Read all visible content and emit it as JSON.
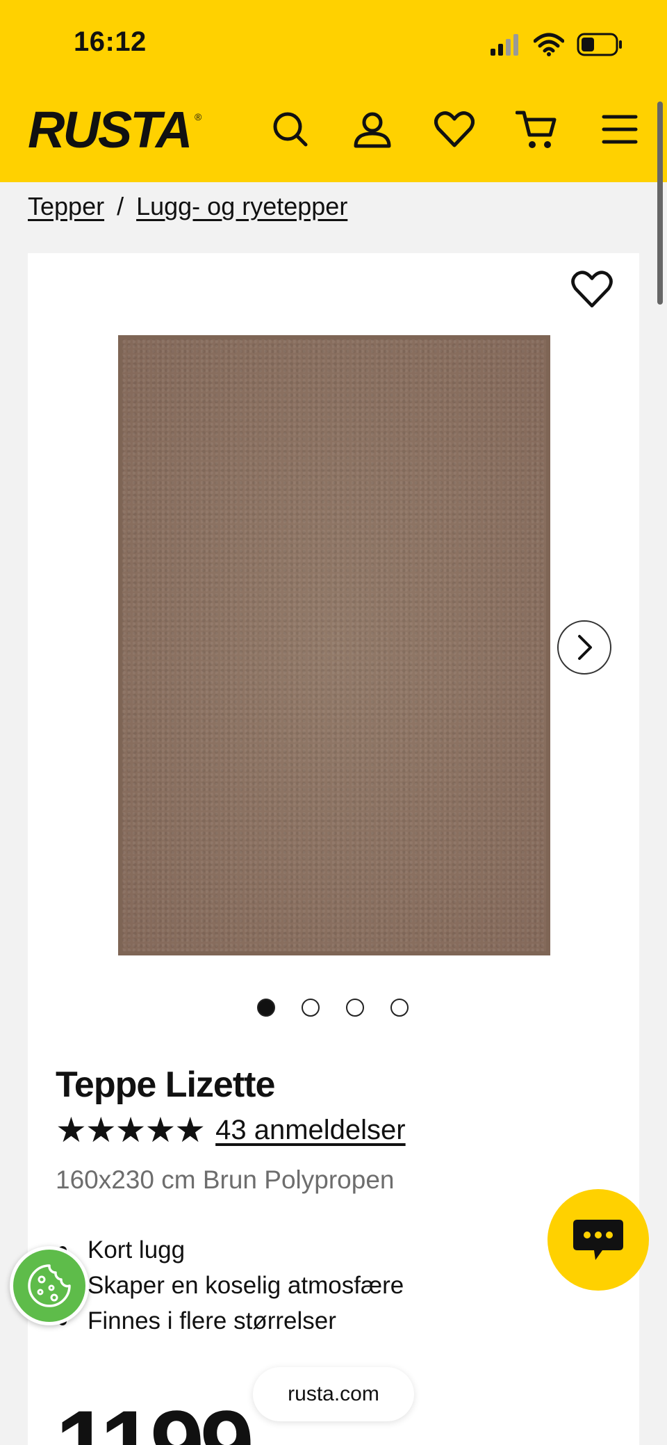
{
  "status_bar": {
    "time": "16:12"
  },
  "header": {
    "logo": "RUSTA",
    "logo_mark": "®",
    "icons": [
      "search-icon",
      "account-icon",
      "wishlist-icon",
      "cart-icon",
      "menu-icon"
    ]
  },
  "breadcrumb": {
    "items": [
      "Tepper",
      "Lugg- og ryetepper"
    ],
    "separator": "/"
  },
  "product": {
    "title": "Teppe Lizette",
    "stars": "★★★★★",
    "rating_stars": 5,
    "reviews": "43 anmeldelser",
    "subtitle": "160x230 cm Brun Polypropen",
    "features": [
      "Kort lugg",
      "Skaper en koselig atmosfære",
      "Finnes i flere størrelser"
    ],
    "price": "1199",
    "image_count": 4,
    "active_image": 1
  },
  "browser": {
    "url": "rusta.com"
  },
  "colors": {
    "brand_yellow": "#ffd100",
    "rug_brown": "#8a705f",
    "cookie_green": "#5ebc4a"
  }
}
